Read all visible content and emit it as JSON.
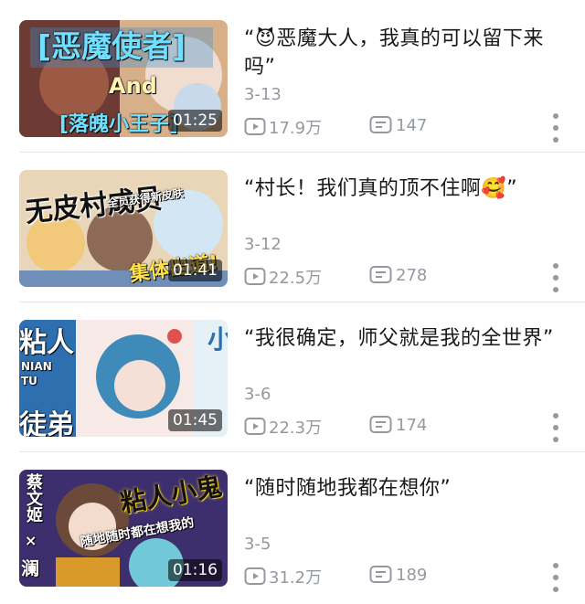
{
  "videos": [
    {
      "title": "“😈恶魔大人，我真的可以留下来吗”",
      "date": "3-13",
      "views": "17.9万",
      "comments": "147",
      "duration": "01:25",
      "thumb_text": [
        "[恶魔使者]",
        "And",
        "[落魄小王子]"
      ],
      "thumb_colors": [
        "#7a3f3a",
        "#c9a075",
        "#1f6fa3"
      ]
    },
    {
      "title": "“村长！我们真的顶不住啊🥰”",
      "date": "3-12",
      "views": "22.5万",
      "comments": "278",
      "duration": "01:41",
      "thumb_text": [
        "无皮村成员",
        "全员获得新皮肤",
        "集体出道!"
      ],
      "thumb_colors": [
        "#e8c27a",
        "#a8d3ef",
        "#c9854a"
      ]
    },
    {
      "title": "“我很确定，师父就是我的全世界”",
      "date": "3-6",
      "views": "22.3万",
      "comments": "174",
      "duration": "01:45",
      "thumb_text": [
        "粘人",
        "NIAN",
        "TU",
        "徒弟",
        "小"
      ],
      "thumb_colors": [
        "#2e6fb0",
        "#e25050",
        "#7bc6ea"
      ]
    },
    {
      "title": "“随时随地我都在想你”",
      "date": "3-5",
      "views": "31.2万",
      "comments": "189",
      "duration": "01:16",
      "thumb_text": [
        "蔡文姬",
        "×",
        "澜",
        "粘人小鬼",
        "随地随时都在想我的"
      ],
      "thumb_colors": [
        "#3d2f6e",
        "#f3d11e",
        "#70c8d8"
      ]
    }
  ],
  "icons": {
    "views": "play-count-icon",
    "comments": "danmaku-icon",
    "more": "more-vertical-icon"
  }
}
